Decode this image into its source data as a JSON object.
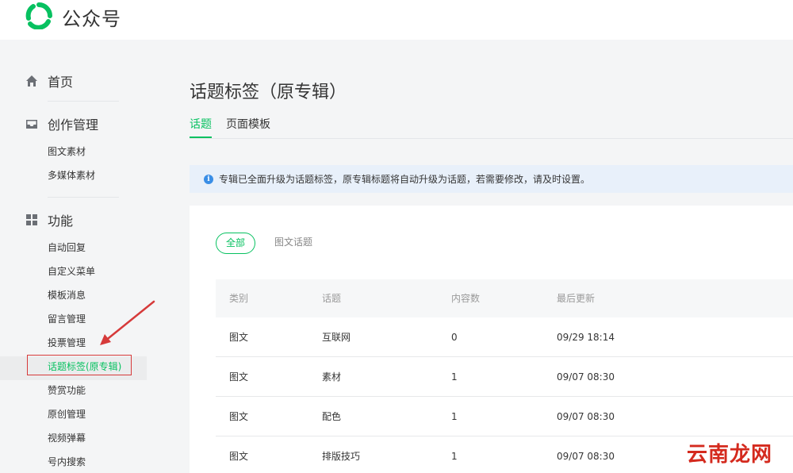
{
  "header": {
    "app_name": "公众号",
    "logo_icon": "wechat-official-account-logo"
  },
  "sidebar": {
    "home": {
      "label": "首页",
      "icon": "home-icon"
    },
    "content": {
      "label": "创作管理",
      "icon": "inbox-icon",
      "items": [
        {
          "label": "图文素材"
        },
        {
          "label": "多媒体素材"
        }
      ]
    },
    "features": {
      "label": "功能",
      "icon": "grid-icon",
      "items": [
        {
          "label": "自动回复"
        },
        {
          "label": "自定义菜单"
        },
        {
          "label": "模板消息"
        },
        {
          "label": "留言管理"
        },
        {
          "label": "投票管理"
        },
        {
          "label": "话题标签(原专辑)",
          "active": true
        },
        {
          "label": "赞赏功能"
        },
        {
          "label": "原创管理"
        },
        {
          "label": "视频弹幕"
        },
        {
          "label": "号内搜索"
        }
      ]
    }
  },
  "main": {
    "title": "话题标签（原专辑）",
    "tabs": [
      {
        "label": "话题",
        "active": true
      },
      {
        "label": "页面模板",
        "active": false
      }
    ],
    "notice": "专辑已全面升级为话题标签，原专辑标题将自动升级为话题，若需要修改，请及时设置。",
    "filters": [
      {
        "label": "全部",
        "active": true
      },
      {
        "label": "图文话题",
        "active": false
      }
    ],
    "table": {
      "headers": [
        "类别",
        "话题",
        "内容数",
        "最后更新"
      ],
      "rows": [
        [
          "图文",
          "互联网",
          "0",
          "09/29 18:14"
        ],
        [
          "图文",
          "素材",
          "1",
          "09/07 08:30"
        ],
        [
          "图文",
          "配色",
          "1",
          "09/07 08:30"
        ],
        [
          "图文",
          "排版技巧",
          "1",
          "09/07 08:30"
        ]
      ]
    }
  },
  "watermark": "云南龙网",
  "colors": {
    "accent": "#07c160",
    "annotation": "#d63a3a",
    "notice_bg": "#e8f0fa"
  }
}
